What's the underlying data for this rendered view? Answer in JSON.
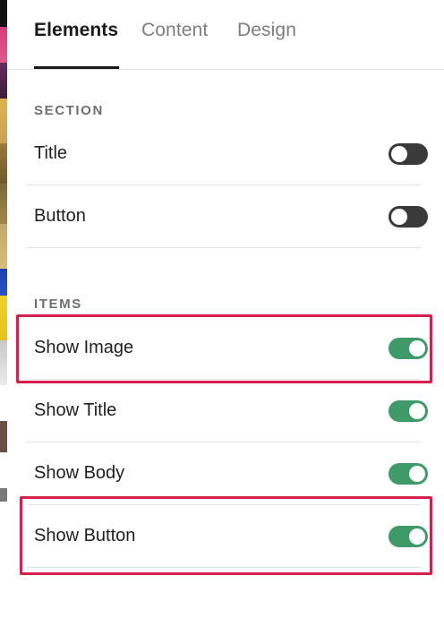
{
  "tabs": [
    {
      "label": "Elements",
      "active": true
    },
    {
      "label": "Content",
      "active": false
    },
    {
      "label": "Design",
      "active": false
    }
  ],
  "section": {
    "heading": "SECTION",
    "rows": [
      {
        "label": "Title",
        "enabled": false
      },
      {
        "label": "Button",
        "enabled": false
      }
    ]
  },
  "items": {
    "heading": "ITEMS",
    "rows": [
      {
        "label": "Show Image",
        "enabled": true,
        "highlighted": true
      },
      {
        "label": "Show Title",
        "enabled": true,
        "highlighted": false
      },
      {
        "label": "Show Body",
        "enabled": true,
        "highlighted": false
      },
      {
        "label": "Show Button",
        "enabled": true,
        "highlighted": true
      }
    ]
  },
  "colors": {
    "toggle_on": "#3f9a6a",
    "toggle_off": "#3a3a3a",
    "highlight": "#d81e4a"
  }
}
